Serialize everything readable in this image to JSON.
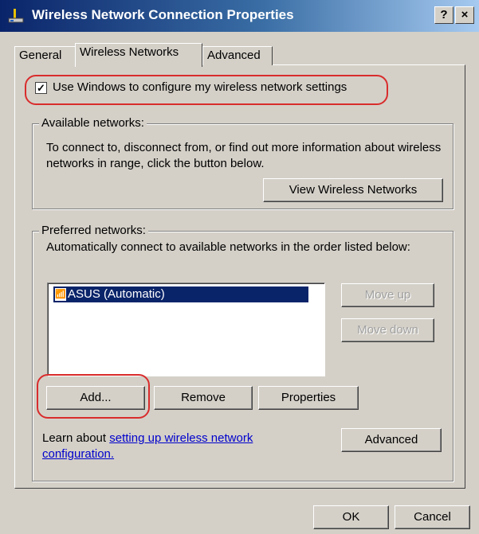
{
  "window": {
    "title": "Wireless Network Connection Properties",
    "help_button": "?",
    "close_button": "×"
  },
  "tabs": [
    {
      "label": "General"
    },
    {
      "label": "Wireless Networks"
    },
    {
      "label": "Advanced"
    }
  ],
  "use_windows": {
    "checked": true,
    "check_glyph": "✓",
    "label": "Use Windows to configure my wireless network settings"
  },
  "available": {
    "legend": "Available networks:",
    "description": "To connect to, disconnect from, or find out more information about wireless networks in range, click the button below.",
    "view_button": "View Wireless Networks"
  },
  "preferred": {
    "legend": "Preferred networks:",
    "description": "Automatically connect to available networks in the order listed below:",
    "networks": [
      {
        "label": "ASUS (Automatic)",
        "icon": "antenna-icon",
        "selected": true
      }
    ],
    "move_up": "Move up",
    "move_down": "Move down",
    "add": "Add...",
    "remove": "Remove",
    "properties": "Properties",
    "learn_prefix": "Learn about ",
    "learn_link": "setting up wireless network configuration.",
    "advanced": "Advanced"
  },
  "footer": {
    "ok": "OK",
    "cancel": "Cancel"
  },
  "colors": {
    "annotation": "#d92c2c",
    "selection": "#0a246a"
  }
}
